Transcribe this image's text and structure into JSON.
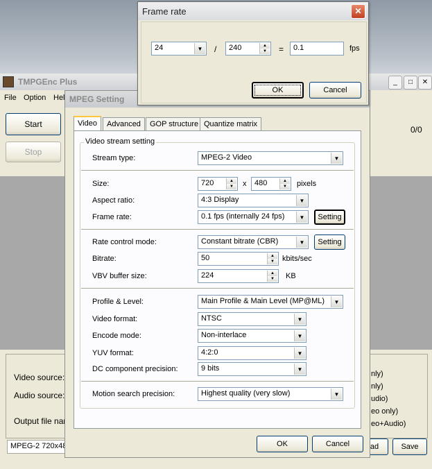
{
  "main_window": {
    "title": "TMPGEnc Plus",
    "menu": [
      "File",
      "Option",
      "Hel"
    ],
    "start_label": "Start",
    "stop_label": "Stop",
    "progress": "0/0",
    "video_source_label": "Video source:",
    "audio_source_label": "Audio source:",
    "output_file_label": "Output file nam",
    "status_text": "MPEG-2 720x48",
    "right_items": [
      "nly)",
      "nly)",
      "udio)",
      "eo only)",
      "eo+Audio)"
    ],
    "load_label": "ad",
    "save_label": "Save"
  },
  "mpeg_dialog": {
    "title": "MPEG Setting",
    "tabs": [
      "Video",
      "Advanced",
      "GOP structure",
      "Quantize matrix"
    ],
    "group_title": "Video stream setting",
    "stream_type": {
      "label": "Stream type:",
      "value": "MPEG-2 Video"
    },
    "size": {
      "label": "Size:",
      "width": "720",
      "x": "x",
      "height": "480",
      "unit": "pixels"
    },
    "aspect_ratio": {
      "label": "Aspect ratio:",
      "value": "4:3 Display"
    },
    "frame_rate": {
      "label": "Frame rate:",
      "value": "0.1 fps (internally 24 fps)",
      "button": "Setting"
    },
    "rate_control": {
      "label": "Rate control mode:",
      "value": "Constant bitrate (CBR)",
      "button": "Setting"
    },
    "bitrate": {
      "label": "Bitrate:",
      "value": "50",
      "unit": "kbits/sec"
    },
    "vbv": {
      "label": "VBV buffer size:",
      "value": "224",
      "unit": "KB"
    },
    "profile": {
      "label": "Profile & Level:",
      "value": "Main Profile & Main Level (MP@ML)"
    },
    "video_format": {
      "label": "Video format:",
      "value": "NTSC"
    },
    "encode_mode": {
      "label": "Encode mode:",
      "value": "Non-interlace"
    },
    "yuv_format": {
      "label": "YUV format:",
      "value": "4:2:0"
    },
    "dc_precision": {
      "label": "DC component precision:",
      "value": "9 bits"
    },
    "motion_search": {
      "label": "Motion search precision:",
      "value": "Highest quality (very slow)"
    },
    "ok_label": "OK",
    "cancel_label": "Cancel"
  },
  "frame_rate_dialog": {
    "title": "Frame rate",
    "numerator": "24",
    "slash": "/",
    "denominator": "240",
    "equals": "=",
    "result": "0.1",
    "unit": "fps",
    "ok_label": "OK",
    "cancel_label": "Cancel"
  }
}
